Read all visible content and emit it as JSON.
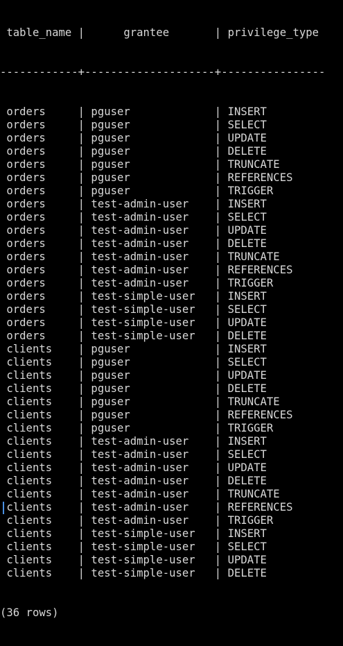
{
  "terminal": {
    "header": " table_name |      grantee       | privilege_type ",
    "separator": "------------+--------------------+----------------",
    "rows": [
      " orders     | pguser             | INSERT",
      " orders     | pguser             | SELECT",
      " orders     | pguser             | UPDATE",
      " orders     | pguser             | DELETE",
      " orders     | pguser             | TRUNCATE",
      " orders     | pguser             | REFERENCES",
      " orders     | pguser             | TRIGGER",
      " orders     | test-admin-user    | INSERT",
      " orders     | test-admin-user    | SELECT",
      " orders     | test-admin-user    | UPDATE",
      " orders     | test-admin-user    | DELETE",
      " orders     | test-admin-user    | TRUNCATE",
      " orders     | test-admin-user    | REFERENCES",
      " orders     | test-admin-user    | TRIGGER",
      " orders     | test-simple-user   | INSERT",
      " orders     | test-simple-user   | SELECT",
      " orders     | test-simple-user   | UPDATE",
      " orders     | test-simple-user   | DELETE",
      " clients    | pguser             | INSERT",
      " clients    | pguser             | SELECT",
      " clients    | pguser             | UPDATE",
      " clients    | pguser             | DELETE",
      " clients    | pguser             | TRUNCATE",
      " clients    | pguser             | REFERENCES",
      " clients    | pguser             | TRIGGER",
      " clients    | test-admin-user    | INSERT",
      " clients    | test-admin-user    | SELECT",
      " clients    | test-admin-user    | UPDATE",
      " clients    | test-admin-user    | DELETE",
      " clients    | test-admin-user    | TRUNCATE",
      " clients    | test-admin-user    | REFERENCES",
      " clients    | test-admin-user    | TRIGGER",
      " clients    | test-simple-user   | INSERT",
      " clients    | test-simple-user   | SELECT",
      " clients    | test-simple-user   | UPDATE",
      " clients    | test-simple-user   | DELETE"
    ],
    "row_count": "(36 rows)",
    "colors": {
      "background": "#000000",
      "text": "#d8d8d8",
      "cursor": "#4a90e2"
    }
  }
}
